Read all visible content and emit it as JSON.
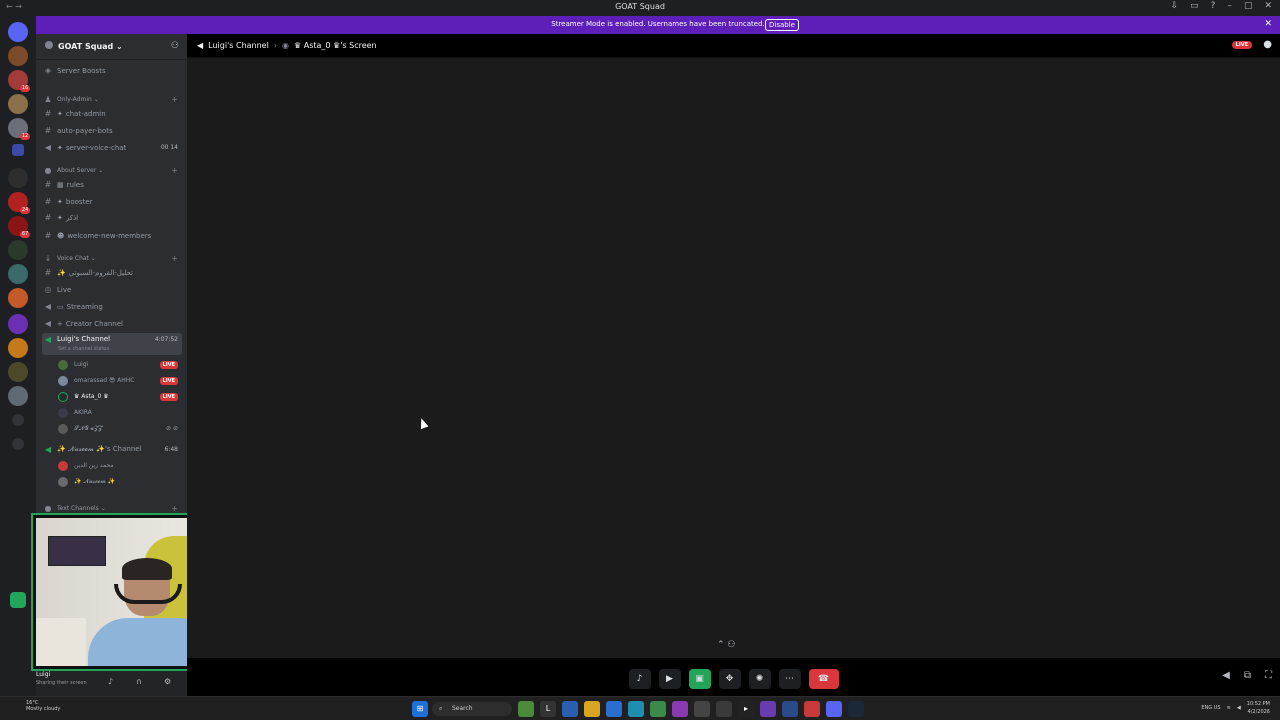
{
  "window": {
    "title": "GOAT Squad",
    "nav": "← →"
  },
  "banner": {
    "text": "Streamer Mode is enabled. Usernames have been truncated.",
    "button": "Disable",
    "close": "✕"
  },
  "server": {
    "name": "GOAT Squad ⌄",
    "boosts": "Server Boosts"
  },
  "categories": {
    "only_admin": "Only-Admin ⌄",
    "about": "About Server ⌄",
    "voice": "Voice Chat ⌄",
    "text": "Text Channels ⌄"
  },
  "channels": {
    "chat_admin": "chat-admin",
    "auto_payer": "auto-payer-bots",
    "server_voice": "server-voice-chat",
    "server_voice_counts": "00 14",
    "rules": "rules",
    "booster": "booster",
    "arabic": "اذكر",
    "welcome": "welcome-new-members",
    "arabic_voice": "تحليل-القروم-السبوتي",
    "live": "Live",
    "streaming": "Streaming",
    "creator": "Creator Channel",
    "luigi": "Luigi's Channel",
    "luigi_time": "4:07:52",
    "luigi_status": "Set a channel status",
    "naseem": "✨ 𝓝𝓪𝓼𝓮𝓮𝓶 ✨'s Channel",
    "naseem_time": "6:48"
  },
  "members": [
    {
      "name": "Luigi",
      "live": "LIVE"
    },
    {
      "name": "omarassad 😎 AHHC",
      "live": "LIVE"
    },
    {
      "name": "♛ Asta_0 ♛",
      "live": "LIVE"
    },
    {
      "name": "AKIRA",
      "live": ""
    },
    {
      "name": "𝓢𝓝𝓖 𝓪𝓩𝓩",
      "live": ""
    }
  ],
  "naseem_members": [
    {
      "name": "محمد زين الدين"
    },
    {
      "name": "✨ 𝓝𝓪𝓼𝓮𝓮𝓶 ✨"
    }
  ],
  "header": {
    "channel": "Luigi's Channel",
    "screen": "♛ Asta_0 ♛'s Screen",
    "live": "LIVE"
  },
  "user": {
    "name": "Luigi",
    "status": "Sharing their screen"
  },
  "taskbar": {
    "weather_temp": "16°C",
    "weather_desc": "Mostly cloudy",
    "search": "Search",
    "lang": "ENG US",
    "time": "10:52 PM",
    "date": "4/2/2026"
  },
  "colors": {
    "accent": "#5d1fb8",
    "live": "#da373c",
    "green": "#23a559"
  }
}
